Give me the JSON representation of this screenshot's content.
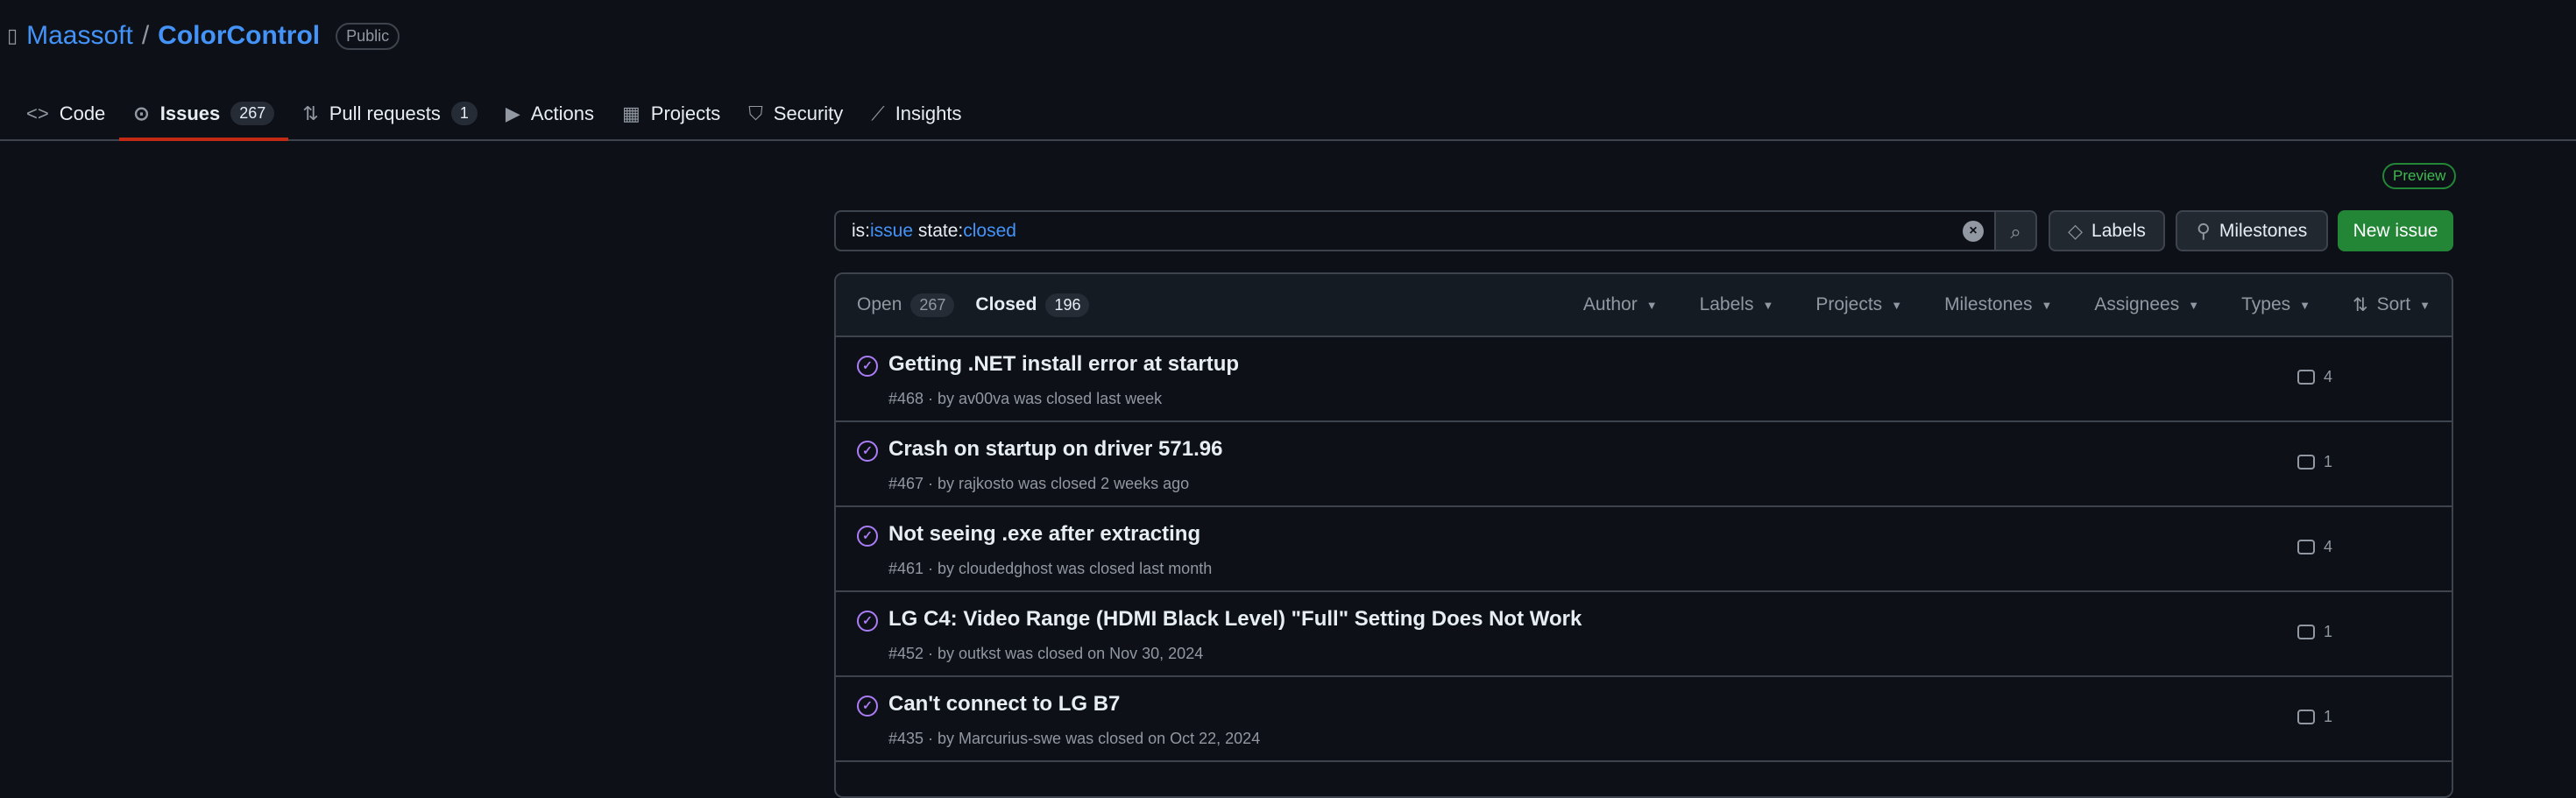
{
  "repo": {
    "owner": "Maassoft",
    "slash": "/",
    "name": "ColorControl",
    "visibility": "Public"
  },
  "tabs": [
    {
      "label": "Code",
      "icon": "code-icon"
    },
    {
      "label": "Issues",
      "count": "267",
      "icon": "issue-icon"
    },
    {
      "label": "Pull requests",
      "count": "1",
      "icon": "pull-request-icon"
    },
    {
      "label": "Actions",
      "icon": "play-icon"
    },
    {
      "label": "Projects",
      "icon": "table-icon"
    },
    {
      "label": "Security",
      "icon": "shield-icon"
    },
    {
      "label": "Insights",
      "icon": "graph-icon"
    }
  ],
  "preview": "Preview",
  "search": {
    "k1": "is:",
    "v1": "issue",
    "k2": " state:",
    "v2": "closed"
  },
  "buttons": {
    "labels": "Labels",
    "milestones": "Milestones",
    "new_issue": "New issue"
  },
  "states": {
    "open": "Open",
    "open_count": "267",
    "closed": "Closed",
    "closed_count": "196"
  },
  "filters": [
    "Author",
    "Labels",
    "Projects",
    "Milestones",
    "Assignees",
    "Types",
    "Sort"
  ],
  "issues": [
    {
      "title": "Getting .NET install error at startup",
      "meta": "#468 · by av00va was closed last week",
      "comments": "4"
    },
    {
      "title": "Crash on startup on driver 571.96",
      "meta": "#467 · by rajkosto was closed 2 weeks ago",
      "comments": "1"
    },
    {
      "title": "Not seeing .exe after extracting",
      "meta": "#461 · by cloudedghost was closed last month",
      "comments": "4"
    },
    {
      "title": "LG C4: Video Range (HDMI Black Level) \"Full\" Setting Does Not Work",
      "meta": "#452 · by outkst was closed on Nov 30, 2024",
      "comments": "1"
    },
    {
      "title": "Can't connect to LG B7",
      "meta": "#435 · by Marcurius-swe was closed on Oct 22, 2024",
      "comments": "1"
    }
  ]
}
